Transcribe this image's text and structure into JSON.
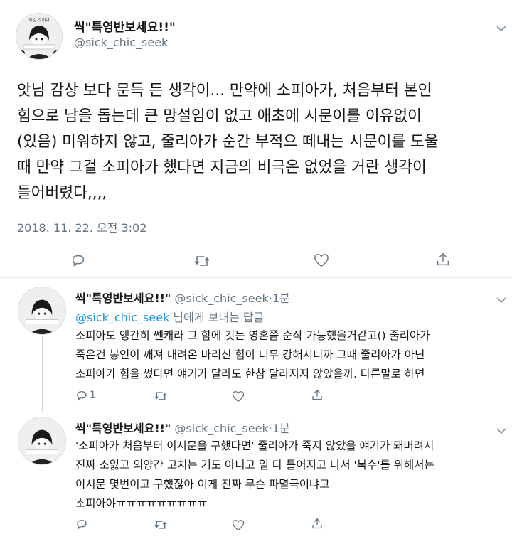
{
  "main_tweet": {
    "display_name": "씩\"특영반보세요!!\"",
    "handle": "@sick_chic_seek",
    "text": "앗님 감상 보다 문득 든 생각이... 만약에 소피아가, 처음부터 본인\n힘으로 남을 돕는데 큰 망설임이 없고 애초에 시문이를 이유없이\n(있음) 미워하지 않고, 줄리아가 순간 부적으 떼내는 시문이를 도울\n때 만약 그걸 소피아가 했다면 지금의 비극은 없었을 거란 생각이\n들어버렸다,,,,",
    "timestamp": "2018. 11. 22. 오전 3:02"
  },
  "reply1": {
    "display_name": "씩\"특영반보세요!!\"",
    "handle": "@sick_chic_seek",
    "time": "1분",
    "reply_to_handle": "@sick_chic_seek",
    "reply_to_suffix": " 님에게 보내는 답글",
    "text": "소피아도 앵간히 쎈캐라 그 함에 깃든 영혼쯤 순삭 가능했을거같고() 줄리아가\n죽은건 봉인이 깨져 내려온 바리신 힘이 너무 강해서니까 그때 줄리아가 아닌\n소피아가 힘을 썼다면 얘기가 달라도 한참 달라지지 않았을까. 다른말로 하면",
    "reply_count": "1"
  },
  "reply2": {
    "display_name": "씩\"특영반보세요!!\"",
    "handle": "@sick_chic_seek",
    "time": "1분",
    "text": "'소피아가 처음부터 이시문을 구했다면' 줄리아가 죽지 않았을 얘기가 돼버려서\n진짜 소잃고 외양간 고치는 거도 아니고 일 다 틀어지고 나서 '복수'를 위해서는\n이시문 몇번이고 구했잖아 이게 진짜 무슨 파멸극이냐고\n소피아야ㅠㅠㅠㅠㅠㅠㅠㅠㅠ"
  },
  "avatar_caption": "죽일 것이다",
  "colors": {
    "link": "#1b95e0",
    "secondary": "#657786",
    "divider": "#e6ecf0"
  },
  "icons": [
    "chevron-down-icon",
    "reply-icon",
    "retweet-icon",
    "like-icon",
    "share-icon"
  ]
}
